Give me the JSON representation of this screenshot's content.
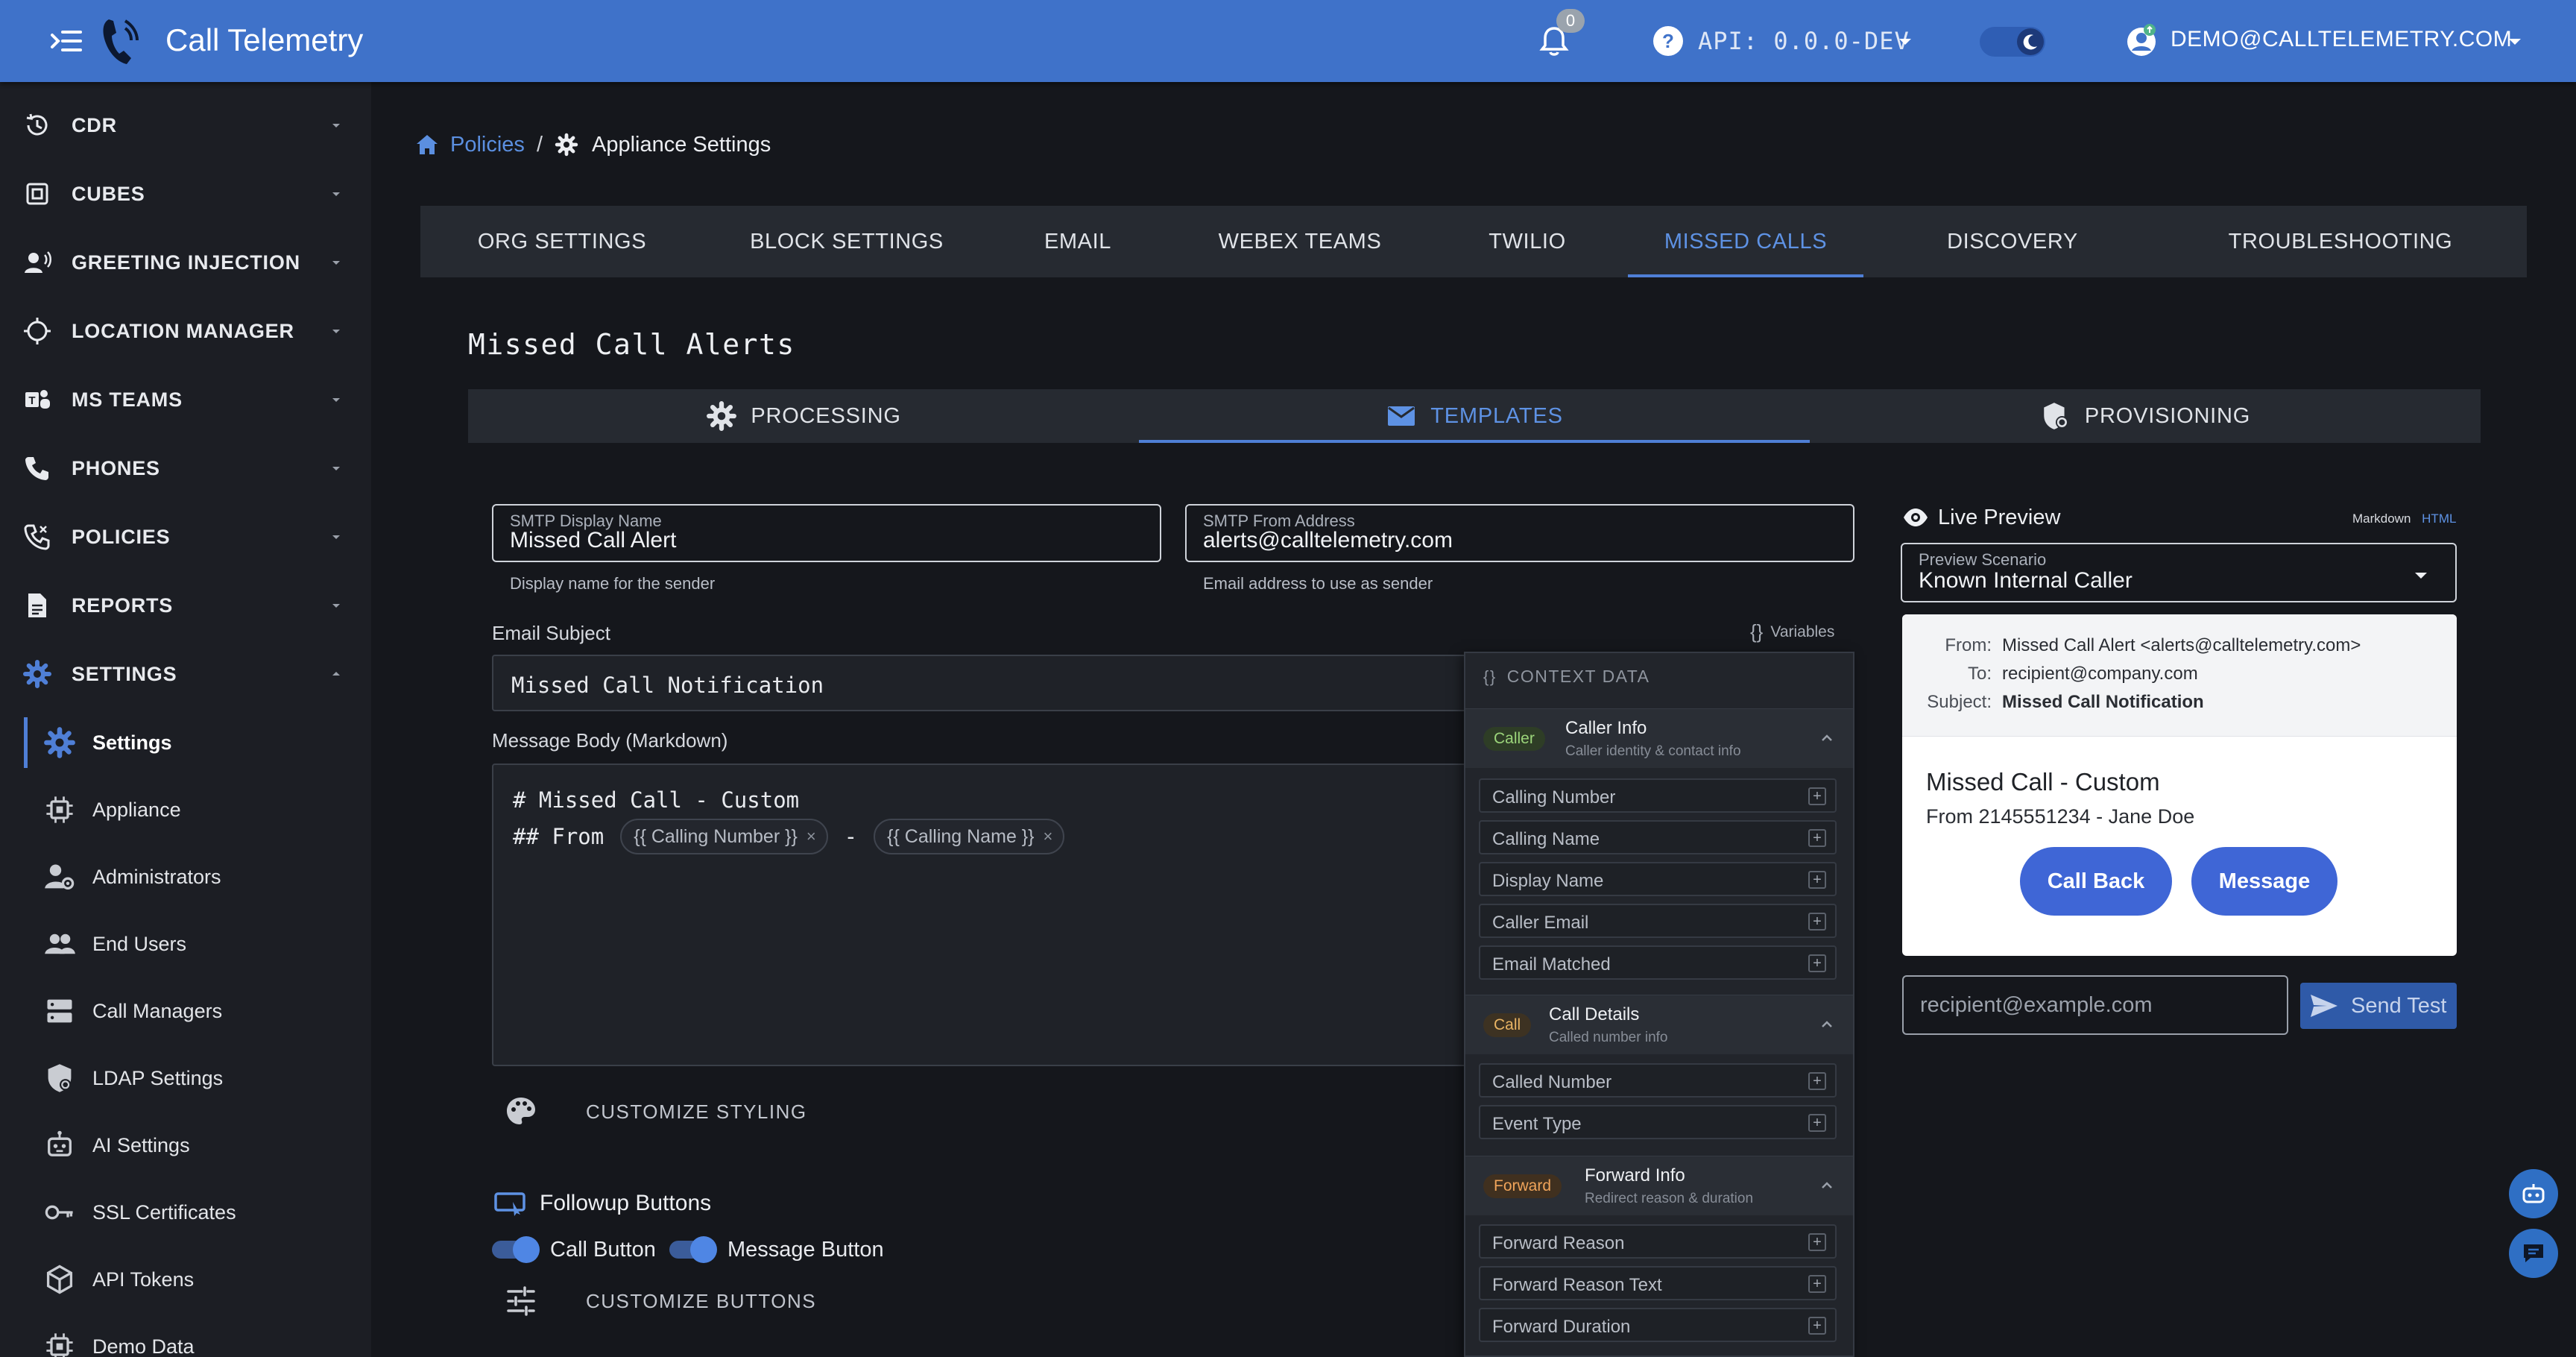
{
  "colors": {
    "topbar": "#3f72c9",
    "accent": "#5e92e4",
    "sidebar": "#1c1e24",
    "background": "#15171c",
    "preview_button": "#3f66d6"
  },
  "header": {
    "app_title": "Call Telemetry",
    "notification_count": "0",
    "api_label": "API: 0.0.0-DEV",
    "user_label": "DEMO@CALLTELEMETRY.COM",
    "icons": [
      "menu-toggle-icon",
      "app-logo",
      "bell-icon",
      "help-icon",
      "chevron-down-icon",
      "theme-toggle",
      "user-icon"
    ]
  },
  "sidebar": {
    "top_items": [
      {
        "label": "CDR",
        "icon": "history-icon"
      },
      {
        "label": "CUBES",
        "icon": "cube-icon"
      },
      {
        "label": "GREETING INJECTION",
        "icon": "voice-icon"
      },
      {
        "label": "LOCATION MANAGER",
        "icon": "location-icon"
      },
      {
        "label": "MS TEAMS",
        "icon": "teams-icon"
      },
      {
        "label": "PHONES",
        "icon": "phone-icon"
      },
      {
        "label": "POLICIES",
        "icon": "policy-phone-icon"
      },
      {
        "label": "REPORTS",
        "icon": "report-icon"
      },
      {
        "label": "SETTINGS",
        "icon": "gear-icon"
      }
    ],
    "sub_items": [
      {
        "label": "Settings",
        "icon": "gear-icon",
        "active": true
      },
      {
        "label": "Appliance",
        "icon": "chip-icon"
      },
      {
        "label": "Administrators",
        "icon": "admin-icon"
      },
      {
        "label": "End Users",
        "icon": "users-icon"
      },
      {
        "label": "Call Managers",
        "icon": "server-icon"
      },
      {
        "label": "LDAP Settings",
        "icon": "shield-icon"
      },
      {
        "label": "AI Settings",
        "icon": "robot-icon"
      },
      {
        "label": "SSL Certificates",
        "icon": "key-icon"
      },
      {
        "label": "API Tokens",
        "icon": "token-icon"
      },
      {
        "label": "Demo Data",
        "icon": "chip-icon"
      }
    ]
  },
  "breadcrumb": {
    "parent": "Policies",
    "separator": "/",
    "current": "Appliance Settings"
  },
  "main_tabs": [
    "ORG SETTINGS",
    "BLOCK SETTINGS",
    "EMAIL",
    "WEBEX TEAMS",
    "TWILIO",
    "MISSED CALLS",
    "DISCOVERY",
    "TROUBLESHOOTING"
  ],
  "main_tab_active": "MISSED CALLS",
  "section_title": "Missed Call Alerts",
  "sub_tabs": [
    {
      "label": "PROCESSING",
      "icon": "gear-icon"
    },
    {
      "label": "TEMPLATES",
      "icon": "mail-icon",
      "active": true
    },
    {
      "label": "PROVISIONING",
      "icon": "shield-gear-icon"
    }
  ],
  "form": {
    "smtp_display_name": {
      "label": "SMTP Display Name",
      "value": "Missed Call Alert",
      "hint": "Display name for the sender"
    },
    "smtp_from_address": {
      "label": "SMTP From Address",
      "value": "alerts@calltelemetry.com",
      "hint": "Email address to use as sender"
    },
    "subject_label": "Email Subject",
    "subject_value": "Missed Call Notification",
    "variables_link": "Variables",
    "body_label": "Message Body (Markdown)",
    "body_line1": "# Missed Call - Custom",
    "body_line2_prefix": "## From",
    "chip_calling_number": "{{ Calling Number }}",
    "chip_calling_name": "{{ Calling Name }}",
    "body_dash": "-",
    "chip_remove": "×",
    "customize_styling": "CUSTOMIZE STYLING",
    "followup_title": "Followup Buttons",
    "call_button_label": "Call Button",
    "call_button_enabled": true,
    "message_button_label": "Message Button",
    "message_button_enabled": true,
    "customize_buttons": "CUSTOMIZE BUTTONS"
  },
  "context_panel": {
    "title": "CONTEXT DATA",
    "groups": [
      {
        "tag": "Caller",
        "tag_color": "#9bd47a",
        "tag_bg": "#2e3d26",
        "title": "Caller Info",
        "subtitle": "Caller identity & contact info",
        "items": [
          "Calling Number",
          "Calling Name",
          "Display Name",
          "Caller Email",
          "Email Matched"
        ]
      },
      {
        "tag": "Call",
        "tag_color": "#e9b464",
        "tag_bg": "#3d3222",
        "title": "Call Details",
        "subtitle": "Called number info",
        "items": [
          "Called Number",
          "Event Type"
        ]
      },
      {
        "tag": "Forward",
        "tag_color": "#f0a45a",
        "tag_bg": "#40301f",
        "title": "Forward Info",
        "subtitle": "Redirect reason & duration",
        "items": [
          "Forward Reason",
          "Forward Reason Text",
          "Forward Duration"
        ]
      }
    ]
  },
  "preview": {
    "title": "Live Preview",
    "mode_markdown": "Markdown",
    "mode_html": "HTML",
    "scenario_label": "Preview Scenario",
    "scenario_value": "Known Internal Caller",
    "from_key": "From:",
    "from_value": "Missed Call Alert <alerts@calltelemetry.com>",
    "to_key": "To:",
    "to_value": "recipient@company.com",
    "subject_key": "Subject:",
    "subject_value": "Missed Call Notification",
    "heading": "Missed Call - Custom",
    "from_line": "From 2145551234 - Jane Doe",
    "call_back_button": "Call Back",
    "message_button": "Message",
    "recipient_placeholder": "recipient@example.com",
    "send_test_button": "Send Test"
  }
}
